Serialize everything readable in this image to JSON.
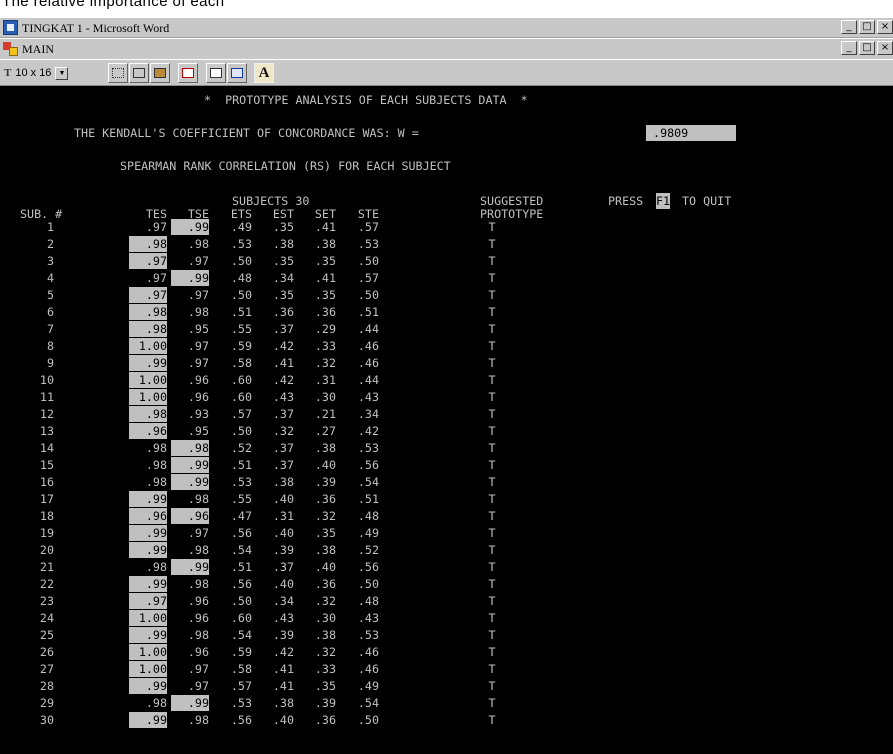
{
  "caption": "The relative importance of each",
  "word_window": {
    "title": "TINGKAT 1 - Microsoft Word",
    "buttons": [
      "_",
      "□",
      "×"
    ]
  },
  "doc_window": {
    "title": "MAIN",
    "buttons": [
      "_",
      "□",
      "×"
    ]
  },
  "toolbar": {
    "font_select_value": "10 x 16",
    "icons": [
      "mark-icon",
      "copy-icon",
      "paste-icon",
      "fullscreen-icon",
      "properties-icon",
      "background-icon",
      "font-icon"
    ],
    "font_button_label": "A"
  },
  "screen": {
    "title": "*  PROTOTYPE ANALYSIS OF EACH SUBJECTS DATA  *",
    "kendall_label": "THE KENDALL'S COEFFICIENT OF CONCORDANCE WAS: W =",
    "kendall_value": " .9809",
    "spearman_label": "SPEARMAN RANK CORRELATION (RS) FOR EACH SUBJECT",
    "subjects_label": "SUBJECTS 30",
    "suggested_label": "SUGGESTED",
    "prototype_label": "PROTOTYPE",
    "press_label": "PRESS",
    "quit_key": "F1",
    "quit_label": "TO QUIT",
    "sub_header": "SUB. #",
    "columns": [
      "TES",
      "TSE",
      "ETS",
      "EST",
      "SET",
      "STE"
    ],
    "rows": [
      {
        "n": "1",
        "v": [
          ".97",
          ".99",
          ".49",
          ".35",
          ".41",
          ".57"
        ],
        "p": "T",
        "hl": [
          1
        ]
      },
      {
        "n": "2",
        "v": [
          ".98",
          ".98",
          ".53",
          ".38",
          ".38",
          ".53"
        ],
        "p": "T",
        "hl": [
          0
        ]
      },
      {
        "n": "3",
        "v": [
          ".97",
          ".97",
          ".50",
          ".35",
          ".35",
          ".50"
        ],
        "p": "T",
        "hl": [
          0
        ]
      },
      {
        "n": "4",
        "v": [
          ".97",
          ".99",
          ".48",
          ".34",
          ".41",
          ".57"
        ],
        "p": "T",
        "hl": [
          1
        ]
      },
      {
        "n": "5",
        "v": [
          ".97",
          ".97",
          ".50",
          ".35",
          ".35",
          ".50"
        ],
        "p": "T",
        "hl": [
          0
        ]
      },
      {
        "n": "6",
        "v": [
          ".98",
          ".98",
          ".51",
          ".36",
          ".36",
          ".51"
        ],
        "p": "T",
        "hl": [
          0
        ]
      },
      {
        "n": "7",
        "v": [
          ".98",
          ".95",
          ".55",
          ".37",
          ".29",
          ".44"
        ],
        "p": "T",
        "hl": [
          0
        ]
      },
      {
        "n": "8",
        "v": [
          "1.00",
          ".97",
          ".59",
          ".42",
          ".33",
          ".46"
        ],
        "p": "T",
        "hl": [
          0
        ]
      },
      {
        "n": "9",
        "v": [
          ".99",
          ".97",
          ".58",
          ".41",
          ".32",
          ".46"
        ],
        "p": "T",
        "hl": [
          0
        ]
      },
      {
        "n": "10",
        "v": [
          "1.00",
          ".96",
          ".60",
          ".42",
          ".31",
          ".44"
        ],
        "p": "T",
        "hl": [
          0
        ]
      },
      {
        "n": "11",
        "v": [
          "1.00",
          ".96",
          ".60",
          ".43",
          ".30",
          ".43"
        ],
        "p": "T",
        "hl": [
          0
        ]
      },
      {
        "n": "12",
        "v": [
          ".98",
          ".93",
          ".57",
          ".37",
          ".21",
          ".34"
        ],
        "p": "T",
        "hl": [
          0
        ]
      },
      {
        "n": "13",
        "v": [
          ".96",
          ".95",
          ".50",
          ".32",
          ".27",
          ".42"
        ],
        "p": "T",
        "hl": [
          0
        ]
      },
      {
        "n": "14",
        "v": [
          ".98",
          ".98",
          ".52",
          ".37",
          ".38",
          ".53"
        ],
        "p": "T",
        "hl": [
          1
        ]
      },
      {
        "n": "15",
        "v": [
          ".98",
          ".99",
          ".51",
          ".37",
          ".40",
          ".56"
        ],
        "p": "T",
        "hl": [
          1
        ]
      },
      {
        "n": "16",
        "v": [
          ".98",
          ".99",
          ".53",
          ".38",
          ".39",
          ".54"
        ],
        "p": "T",
        "hl": [
          1
        ]
      },
      {
        "n": "17",
        "v": [
          ".99",
          ".98",
          ".55",
          ".40",
          ".36",
          ".51"
        ],
        "p": "T",
        "hl": [
          0
        ]
      },
      {
        "n": "18",
        "v": [
          ".96",
          ".96",
          ".47",
          ".31",
          ".32",
          ".48"
        ],
        "p": "T",
        "hl": [
          0,
          1
        ]
      },
      {
        "n": "19",
        "v": [
          ".99",
          ".97",
          ".56",
          ".40",
          ".35",
          ".49"
        ],
        "p": "T",
        "hl": [
          0
        ]
      },
      {
        "n": "20",
        "v": [
          ".99",
          ".98",
          ".54",
          ".39",
          ".38",
          ".52"
        ],
        "p": "T",
        "hl": [
          0
        ]
      },
      {
        "n": "21",
        "v": [
          ".98",
          ".99",
          ".51",
          ".37",
          ".40",
          ".56"
        ],
        "p": "T",
        "hl": [
          1
        ]
      },
      {
        "n": "22",
        "v": [
          ".99",
          ".98",
          ".56",
          ".40",
          ".36",
          ".50"
        ],
        "p": "T",
        "hl": [
          0
        ]
      },
      {
        "n": "23",
        "v": [
          ".97",
          ".96",
          ".50",
          ".34",
          ".32",
          ".48"
        ],
        "p": "T",
        "hl": [
          0
        ]
      },
      {
        "n": "24",
        "v": [
          "1.00",
          ".96",
          ".60",
          ".43",
          ".30",
          ".43"
        ],
        "p": "T",
        "hl": [
          0
        ]
      },
      {
        "n": "25",
        "v": [
          ".99",
          ".98",
          ".54",
          ".39",
          ".38",
          ".53"
        ],
        "p": "T",
        "hl": [
          0
        ]
      },
      {
        "n": "26",
        "v": [
          "1.00",
          ".96",
          ".59",
          ".42",
          ".32",
          ".46"
        ],
        "p": "T",
        "hl": [
          0
        ]
      },
      {
        "n": "27",
        "v": [
          "1.00",
          ".97",
          ".58",
          ".41",
          ".33",
          ".46"
        ],
        "p": "T",
        "hl": [
          0
        ]
      },
      {
        "n": "28",
        "v": [
          ".99",
          ".97",
          ".57",
          ".41",
          ".35",
          ".49"
        ],
        "p": "T",
        "hl": [
          0
        ]
      },
      {
        "n": "29",
        "v": [
          ".98",
          ".99",
          ".53",
          ".38",
          ".39",
          ".54"
        ],
        "p": "T",
        "hl": [
          1
        ]
      },
      {
        "n": "30",
        "v": [
          ".99",
          ".98",
          ".56",
          ".40",
          ".36",
          ".50"
        ],
        "p": "T",
        "hl": [
          0
        ]
      }
    ]
  },
  "colors": {
    "console_bg": "#000000",
    "console_fg": "#c0c0c0",
    "highlight_bg": "#c0c0c0",
    "highlight_fg": "#000000"
  }
}
